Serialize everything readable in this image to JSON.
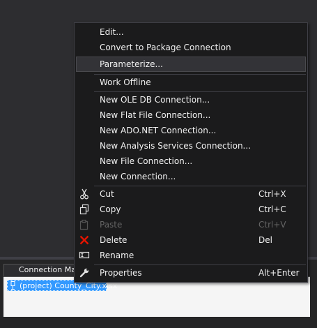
{
  "connection_managers": {
    "tab_label": "Connection Mar",
    "item": "(project) County_City.xlsx"
  },
  "context_menu": {
    "edit": "Edit...",
    "convert": "Convert to Package Connection",
    "parameterize": "Parameterize...",
    "work_offline": "Work Offline",
    "new_oledb": "New OLE DB Connection...",
    "new_flatfile": "New Flat File Connection...",
    "new_adonet": "New ADO.NET Connection...",
    "new_analysis": "New Analysis Services Connection...",
    "new_file": "New File Connection...",
    "new_connection": "New Connection...",
    "cut": "Cut",
    "cut_sc": "Ctrl+X",
    "copy": "Copy",
    "copy_sc": "Ctrl+C",
    "paste": "Paste",
    "paste_sc": "Ctrl+V",
    "delete": "Delete",
    "delete_sc": "Del",
    "rename": "Rename",
    "properties": "Properties",
    "properties_sc": "Alt+Enter"
  },
  "colors": {
    "menu_bg": "#1b1b1c",
    "hover_bg": "#333337",
    "selection": "#3399ff",
    "delete_icon": "#e51400",
    "disabled_text": "#656565"
  }
}
